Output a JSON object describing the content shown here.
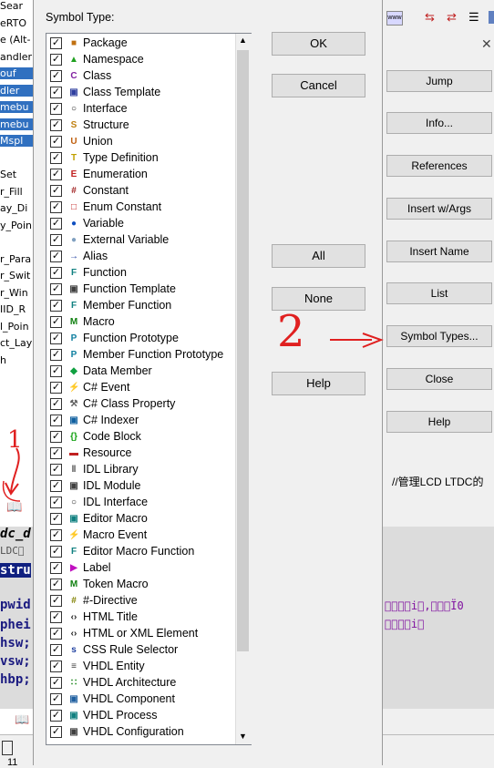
{
  "bg_left": {
    "lines": [
      "Sear",
      "eRTO",
      "e (Alt-",
      "andler",
      "ouf",
      "dler",
      "mebu",
      "mebu",
      "Mspl",
      "",
      "Set",
      "r_Fill",
      "ay_Di",
      "y_Poin",
      "",
      "r_Para",
      "r_Swit",
      "r_Win",
      "IID_R",
      "l_Poin",
      "ct_Lay",
      "h"
    ]
  },
  "code": {
    "title": "dc_d",
    "lines": [
      "LDC\u0000",
      "stru",
      "pwid",
      "phei",
      "hsw;",
      "vsw;",
      "hbp;"
    ],
    "garbled_1": "\u0000\u0000\u0000\u0000i\u0000,\u0000\u0000\u0000Ï0",
    "garbled_2": "\u0000\u0000\u0000\u0000i\u0000"
  },
  "comment": "//管理LCD LTDC的",
  "status": {
    "left": "11"
  },
  "side_buttons": [
    "Jump",
    "Info...",
    "References",
    "Insert w/Args",
    "Insert Name",
    "List",
    "Symbol Types...",
    "Close",
    "Help"
  ],
  "dialog": {
    "title": "Symbol Type:",
    "buttons": {
      "ok": "OK",
      "cancel": "Cancel",
      "all": "All",
      "none": "None",
      "help": "Help"
    },
    "items": [
      {
        "label": "Package",
        "icon": "package-icon",
        "color": "#c07010",
        "glyph": "■"
      },
      {
        "label": "Namespace",
        "icon": "namespace-icon",
        "color": "#20a020",
        "glyph": "▲"
      },
      {
        "label": "Class",
        "icon": "class-icon",
        "color": "#8020a0",
        "glyph": "C"
      },
      {
        "label": "Class Template",
        "icon": "class-template-icon",
        "color": "#3040a0",
        "glyph": "▣"
      },
      {
        "label": "Interface",
        "icon": "interface-icon",
        "color": "#202020",
        "glyph": "○"
      },
      {
        "label": "Structure",
        "icon": "structure-icon",
        "color": "#c08010",
        "glyph": "S"
      },
      {
        "label": "Union",
        "icon": "union-icon",
        "color": "#c06010",
        "glyph": "U"
      },
      {
        "label": "Type Definition",
        "icon": "typedef-icon",
        "color": "#c0a000",
        "glyph": "T"
      },
      {
        "label": "Enumeration",
        "icon": "enumeration-icon",
        "color": "#c02020",
        "glyph": "E"
      },
      {
        "label": "Constant",
        "icon": "constant-icon",
        "color": "#a02020",
        "glyph": "#"
      },
      {
        "label": "Enum Constant",
        "icon": "enum-constant-icon",
        "color": "#c02020",
        "glyph": "□"
      },
      {
        "label": "Variable",
        "icon": "variable-icon",
        "color": "#1050c0",
        "glyph": "●"
      },
      {
        "label": "External Variable",
        "icon": "external-variable-icon",
        "color": "#80a0c0",
        "glyph": "●"
      },
      {
        "label": "Alias",
        "icon": "alias-icon",
        "color": "#2040a0",
        "glyph": "→"
      },
      {
        "label": "Function",
        "icon": "function-icon",
        "color": "#108080",
        "glyph": "F"
      },
      {
        "label": "Function Template",
        "icon": "function-template-icon",
        "color": "#404040",
        "glyph": "▣"
      },
      {
        "label": "Member Function",
        "icon": "member-function-icon",
        "color": "#108080",
        "glyph": "F"
      },
      {
        "label": "Macro",
        "icon": "macro-icon",
        "color": "#108010",
        "glyph": "M"
      },
      {
        "label": "Function Prototype",
        "icon": "function-prototype-icon",
        "color": "#1080a0",
        "glyph": "P"
      },
      {
        "label": "Member Function Prototype",
        "icon": "member-function-prototype-icon",
        "color": "#1080a0",
        "glyph": "P"
      },
      {
        "label": "Data Member",
        "icon": "data-member-icon",
        "color": "#10a040",
        "glyph": "◆"
      },
      {
        "label": "C# Event",
        "icon": "event-icon",
        "color": "#c08010",
        "glyph": "⚡"
      },
      {
        "label": "C# Class Property",
        "icon": "class-property-icon",
        "color": "#606060",
        "glyph": "⚒"
      },
      {
        "label": "C# Indexer",
        "icon": "indexer-icon",
        "color": "#1060a0",
        "glyph": "▣"
      },
      {
        "label": "Code Block",
        "icon": "code-block-icon",
        "color": "#10a010",
        "glyph": "{}"
      },
      {
        "label": "Resource",
        "icon": "resource-icon",
        "color": "#c02020",
        "glyph": "▬"
      },
      {
        "label": "IDL Library",
        "icon": "idl-library-icon",
        "color": "#404040",
        "glyph": "‖"
      },
      {
        "label": "IDL Module",
        "icon": "idl-module-icon",
        "color": "#404040",
        "glyph": "▣"
      },
      {
        "label": "IDL Interface",
        "icon": "idl-interface-icon",
        "color": "#202020",
        "glyph": "○"
      },
      {
        "label": "Editor Macro",
        "icon": "editor-macro-icon",
        "color": "#108080",
        "glyph": "▣"
      },
      {
        "label": "Macro Event",
        "icon": "macro-event-icon",
        "color": "#c02020",
        "glyph": "⚡"
      },
      {
        "label": "Editor Macro Function",
        "icon": "editor-macro-function-icon",
        "color": "#108080",
        "glyph": "F"
      },
      {
        "label": "Label",
        "icon": "label-icon",
        "color": "#c010c0",
        "glyph": "▶"
      },
      {
        "label": "Token Macro",
        "icon": "token-macro-icon",
        "color": "#108010",
        "glyph": "M"
      },
      {
        "label": "#-Directive",
        "icon": "directive-icon",
        "color": "#808000",
        "glyph": "#"
      },
      {
        "label": "HTML Title",
        "icon": "html-title-icon",
        "color": "#202020",
        "glyph": "‹›"
      },
      {
        "label": "HTML or XML Element",
        "icon": "html-element-icon",
        "color": "#202020",
        "glyph": "‹›"
      },
      {
        "label": "CSS Rule Selector",
        "icon": "css-rule-icon",
        "color": "#2040a0",
        "glyph": "s"
      },
      {
        "label": "VHDL Entity",
        "icon": "vhdl-entity-icon",
        "color": "#404040",
        "glyph": "≡"
      },
      {
        "label": "VHDL Architecture",
        "icon": "vhdl-architecture-icon",
        "color": "#108010",
        "glyph": "∷"
      },
      {
        "label": "VHDL Component",
        "icon": "vhdl-component-icon",
        "color": "#2060a0",
        "glyph": "▣"
      },
      {
        "label": "VHDL Process",
        "icon": "vhdl-process-icon",
        "color": "#108080",
        "glyph": "▣"
      },
      {
        "label": "VHDL Configuration",
        "icon": "vhdl-configuration-icon",
        "color": "#404040",
        "glyph": "▣"
      }
    ]
  },
  "annotations": {
    "one": "1",
    "two": "2",
    "color": "#e02020"
  }
}
